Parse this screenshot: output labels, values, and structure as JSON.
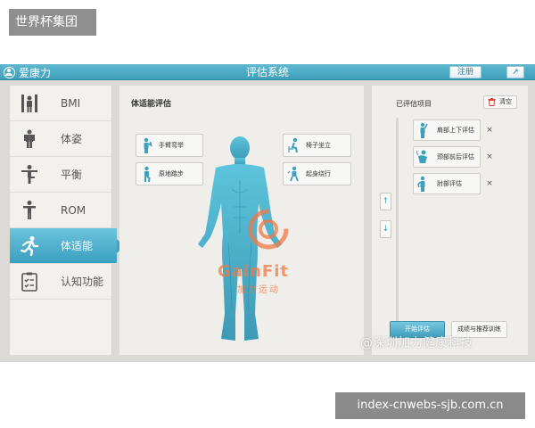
{
  "overlay": {
    "top_tag": "世界杯集团",
    "bottom_tag": "index-cnwebs-sjb.com.cn",
    "watermark_text": "@深圳加力健康科技"
  },
  "header": {
    "brand": "爱康力",
    "title": "评估系统",
    "register_label": "注册",
    "share_icon": "↗"
  },
  "sidebar": {
    "active_index": 4,
    "items": [
      {
        "label": "BMI",
        "icon": "bmi-icon"
      },
      {
        "label": "体姿",
        "icon": "posture-icon"
      },
      {
        "label": "平衡",
        "icon": "balance-icon"
      },
      {
        "label": "ROM",
        "icon": "rom-icon"
      },
      {
        "label": "体适能",
        "icon": "running-icon"
      },
      {
        "label": "认知功能",
        "icon": "checklist-icon"
      }
    ]
  },
  "main": {
    "title": "体适能评估",
    "tests": [
      {
        "label": "手臂弯举"
      },
      {
        "label": "原地踏步"
      },
      {
        "label": "椅子坐立"
      },
      {
        "label": "起身绕行"
      }
    ],
    "logo_text": "GainFit",
    "logo_sub": "加力运动"
  },
  "right": {
    "title": "已评估项目",
    "clear_label": "清空",
    "up_arrow": "↑",
    "down_arrow": "↓",
    "items": [
      {
        "label": "肩部上下评估"
      },
      {
        "label": "颈部前后评估"
      },
      {
        "label": "肘部评估"
      }
    ],
    "remove_symbol": "×",
    "start_label": "开始评估",
    "result_label": "成绩与推荐训练"
  },
  "colors": {
    "accent": "#3ea0bd",
    "body": "#4fb6cf"
  }
}
